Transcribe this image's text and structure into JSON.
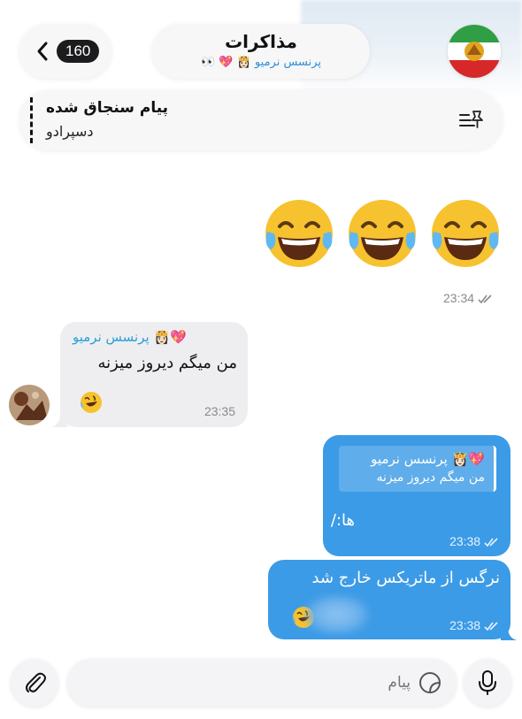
{
  "header": {
    "back_count": "160",
    "title": "مذاکرات",
    "subtitle": "پرنسس نرمیو"
  },
  "pinned": {
    "title": "پیام سنجاق شده",
    "text": "دسپرادو"
  },
  "messages": {
    "emoji_msg": {
      "time": "23:34"
    },
    "incoming": {
      "sender": "پرنسس نرمیو",
      "text": "من میگم دیروز میزنه",
      "time": "23:35"
    },
    "outgoing_reply": {
      "reply_sender": "پرنسس نرمیو",
      "reply_text": "من میگم دیروز میزنه",
      "text": "ها:/",
      "time": "23:38"
    },
    "outgoing_2": {
      "text": "نرگس از ماتریکس خارج شد",
      "time": "23:38"
    }
  },
  "composer": {
    "placeholder": "پیام"
  },
  "colors": {
    "outgoing_bubble": "#3c9be6",
    "incoming_bubble": "#eeeef0",
    "accent_name": "#2a9fd6"
  }
}
